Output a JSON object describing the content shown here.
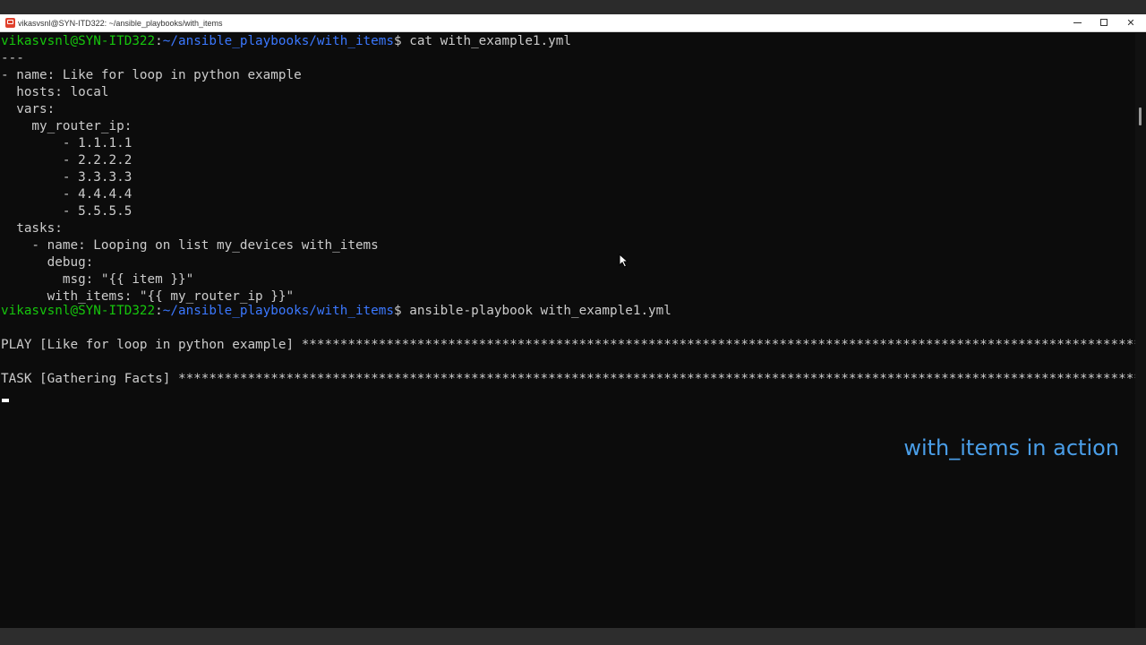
{
  "window": {
    "title": "vikasvsnl@SYN-ITD322: ~/ansible_playbooks/with_items",
    "controls": {
      "minimize": "minimize",
      "maximize": "maximize",
      "close": "✕"
    }
  },
  "terminal": {
    "prompt": {
      "user": "vikasvsnl@SYN-ITD322",
      "separator": ":",
      "path": "~/ansible_playbooks/with_items",
      "symbol": "$"
    },
    "command1": " cat with_example1.yml",
    "yaml_lines": [
      "---",
      "- name: Like for loop in python example",
      "  hosts: local",
      "  vars:",
      "    my_router_ip:",
      "        - 1.1.1.1",
      "        - 2.2.2.2",
      "        - 3.3.3.3",
      "        - 4.4.4.4",
      "        - 5.5.5.5",
      "  tasks:",
      "    - name: Looping on list my_devices with_items",
      "      debug:",
      "        msg: \"{{ item }}\"",
      "      with_items: \"{{ my_router_ip }}\""
    ],
    "command2": " ansible-playbook with_example1.yml",
    "play_line": "PLAY [Like for loop in python example] *********************************************************************************************************************************",
    "task_line": "TASK [Gathering Facts] *************************************************************************************************************************************************"
  },
  "overlay": {
    "caption": "with_items in action"
  },
  "colors": {
    "background": "#0c0c0c",
    "foreground": "#cccccc",
    "prompt_user": "#16c60c",
    "prompt_path": "#3b78ff",
    "caption": "#4a9ee8"
  }
}
